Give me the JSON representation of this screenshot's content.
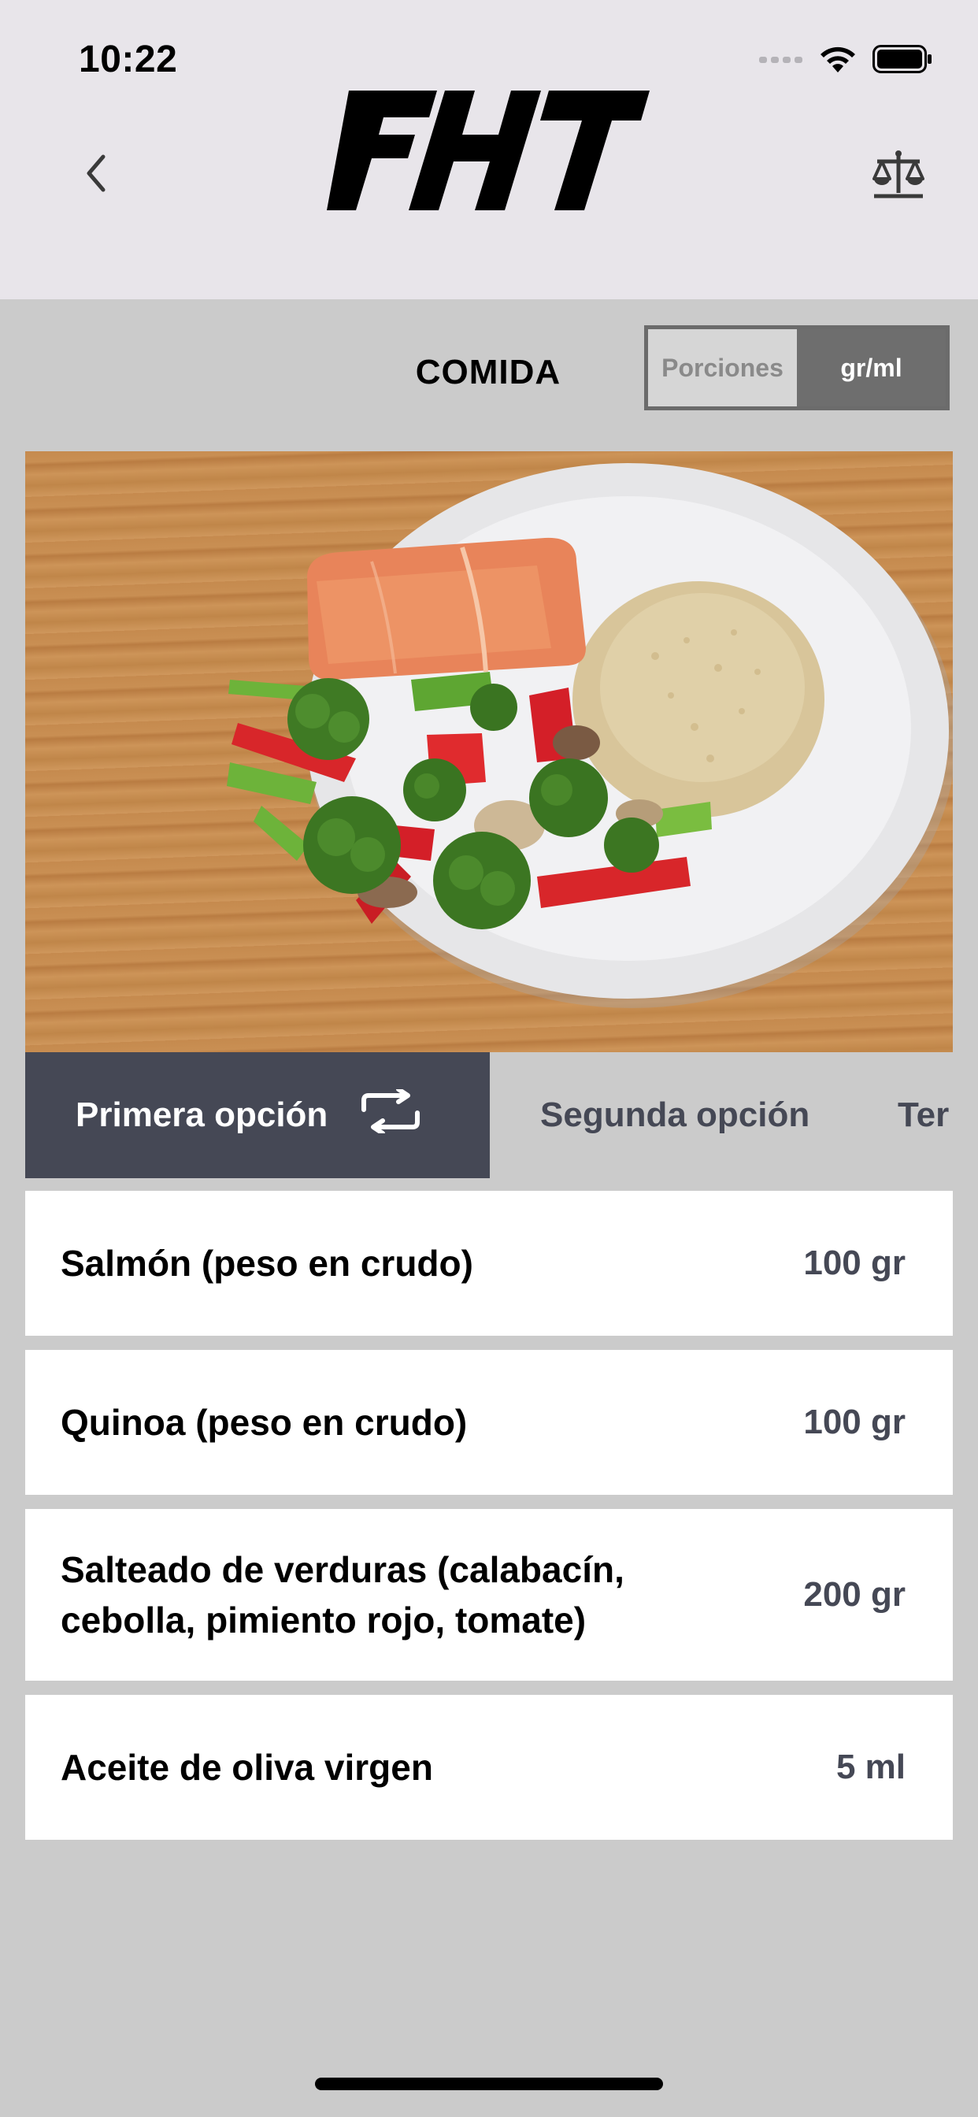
{
  "status_bar": {
    "time": "10:22",
    "signal_icon": "cellular-signal-icon",
    "wifi_icon": "wifi-icon",
    "battery_icon": "battery-icon"
  },
  "header": {
    "back_icon": "chevron-left-icon",
    "logo_text": "FHT",
    "scale_icon": "balance-scale-icon"
  },
  "meal": {
    "title": "COMIDA",
    "unit_toggle": {
      "options": [
        "Porciones",
        "gr/ml"
      ],
      "selected": "gr/ml"
    },
    "photo_description": "Salmón con quinoa y verduras salteadas"
  },
  "tabs": [
    {
      "label": "Primera opción",
      "active": true,
      "icon": "swap-icon"
    },
    {
      "label": "Segunda opción",
      "active": false
    },
    {
      "label": "Ter",
      "active": false
    }
  ],
  "ingredients": [
    {
      "name": "Salmón (peso en crudo)",
      "qty": "100 gr"
    },
    {
      "name": "Quinoa (peso en crudo)",
      "qty": "100 gr"
    },
    {
      "name": "Salteado de verduras (calabacín, cebolla, pimiento rojo, tomate)",
      "qty": "200 gr"
    },
    {
      "name": "Aceite de oliva virgen",
      "qty": "5 ml"
    }
  ],
  "colors": {
    "header_bg": "#e8e5ea",
    "page_bg": "#cbcbcb",
    "active_tab": "#454855",
    "toggle_active": "#6e6e6e"
  }
}
